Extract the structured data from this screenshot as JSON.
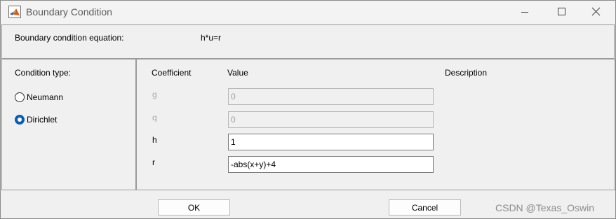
{
  "window": {
    "title": "Boundary Condition",
    "icon": "matlab-logo-icon",
    "controls": {
      "minimize": "minimize-icon",
      "maximize": "maximize-icon",
      "close": "close-icon"
    }
  },
  "equation": {
    "label": "Boundary condition equation:",
    "value": "h*u=r"
  },
  "condition_type": {
    "title": "Condition type:",
    "options": [
      {
        "label": "Neumann",
        "checked": false
      },
      {
        "label": "Dirichlet",
        "checked": true
      }
    ]
  },
  "table": {
    "headers": {
      "coefficient": "Coefficient",
      "value": "Value",
      "description": "Description"
    },
    "rows": [
      {
        "name": "g",
        "value": "0",
        "enabled": false
      },
      {
        "name": "q",
        "value": "0",
        "enabled": false
      },
      {
        "name": "h",
        "value": "1",
        "enabled": true
      },
      {
        "name": "r",
        "value": "-abs(x+y)+4",
        "enabled": true
      }
    ]
  },
  "buttons": {
    "ok": "OK",
    "cancel": "Cancel"
  },
  "watermark": "CSDN @Texas_Oswin",
  "colors": {
    "accent": "#0a5fb5",
    "disabled_text": "#a0a0a0"
  }
}
